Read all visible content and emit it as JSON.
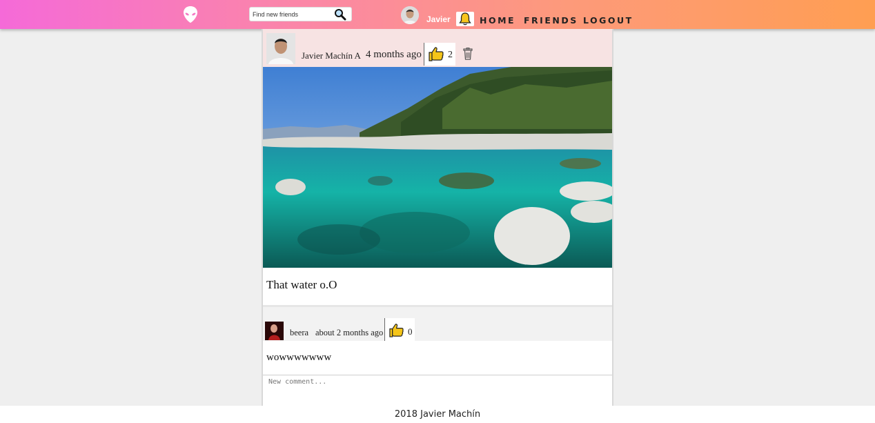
{
  "nav": {
    "logo_icon": "alien-head-icon",
    "search": {
      "placeholder": "Find new friends",
      "value": "",
      "button_icon": "magnifier-icon"
    },
    "user": {
      "name": "Javier",
      "avatar_icon": "user-avatar"
    },
    "notifications_icon": "bell-icon",
    "links": {
      "home": "HOME",
      "friends": "FRIENDS",
      "logout": "LOGOUT"
    }
  },
  "post": {
    "author": "Javier Machín A",
    "time": "4 months ago",
    "likes": "2",
    "like_icon": "thumbs-up-icon",
    "delete_icon": "trash-icon",
    "image": "lake-with-turquoise-water-and-rocks",
    "caption": "That water o.O"
  },
  "comment": {
    "author": "beera",
    "time": "about 2 months ago",
    "likes": "0",
    "text": "wowwwwwww"
  },
  "new_comment": {
    "placeholder": "New comment...",
    "value": ""
  },
  "footer": {
    "text": "2018 Javier Machín"
  },
  "colors": {
    "nav_gradient_start": "#f56ad8",
    "nav_gradient_end": "#ff9e52",
    "post_header_bg": "#f7e3e3",
    "like_icon": "#f5c518"
  }
}
